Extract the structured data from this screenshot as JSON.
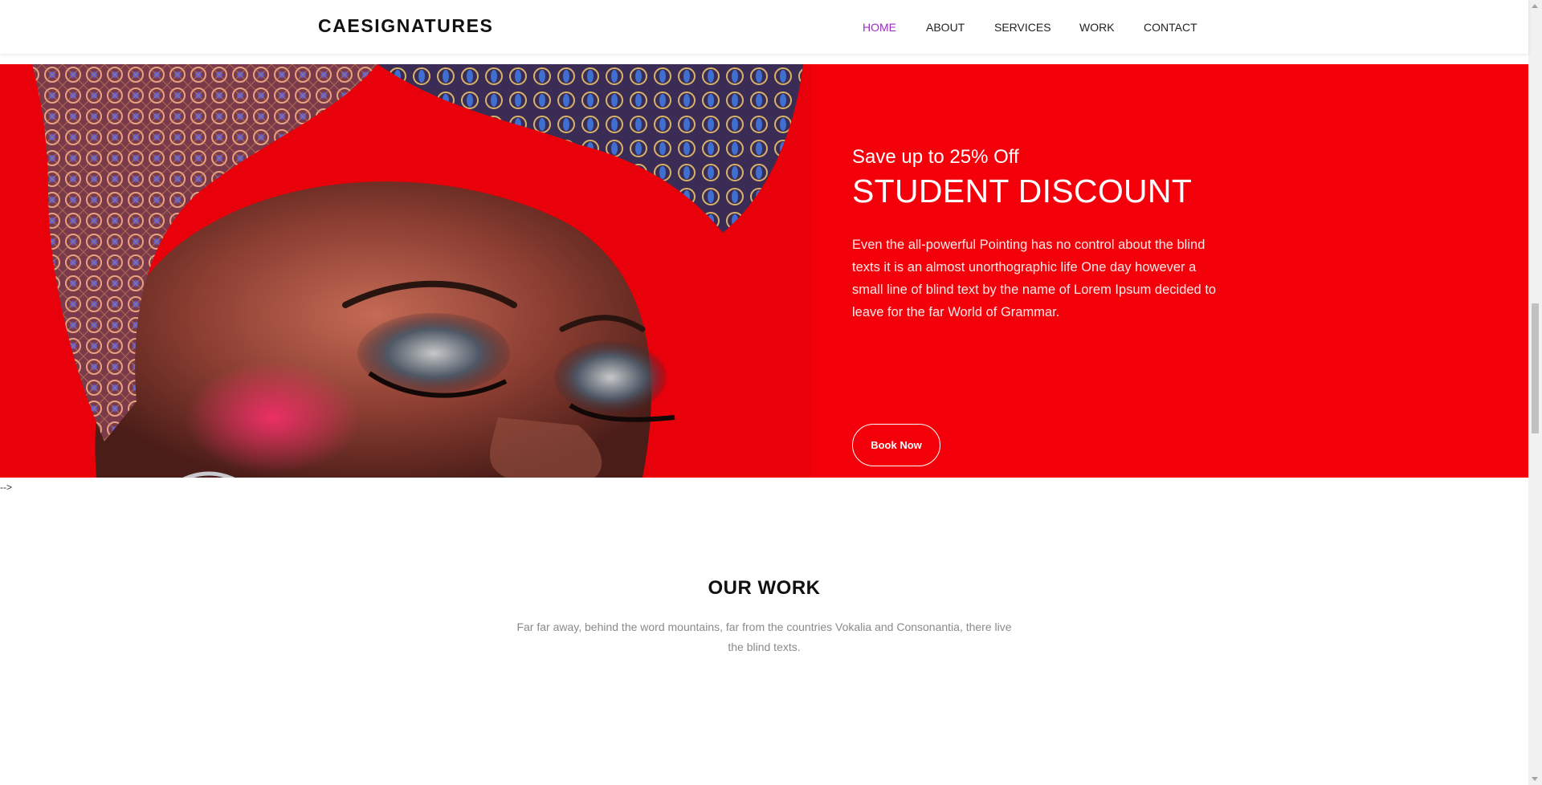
{
  "header": {
    "brand": "CAESIGNATURES",
    "nav": [
      "HOME",
      "ABOUT",
      "SERVICES",
      "WORK",
      "CONTACT"
    ]
  },
  "hero": {
    "subtitle": "Save up to 25% Off",
    "title": "STUDENT DISCOUNT",
    "description": "Even the all-powerful Pointing has no control about the blind texts it is an almost unorthographic life One day however a small line of blind text by the name of Lorem Ipsum decided to leave for the far World of Grammar.",
    "button": "Book Now",
    "image": "woman-with-headwrap-photo"
  },
  "stray_text": "-->",
  "work": {
    "title": "OUR WORK",
    "description": "Far far away, behind the word mountains, far from the countries Vokalia and Consonantia, there live the blind texts."
  },
  "colors": {
    "hero_background": "#f3000a",
    "nav_active": "#9b2bc2",
    "text_muted": "#8a8a8a"
  }
}
